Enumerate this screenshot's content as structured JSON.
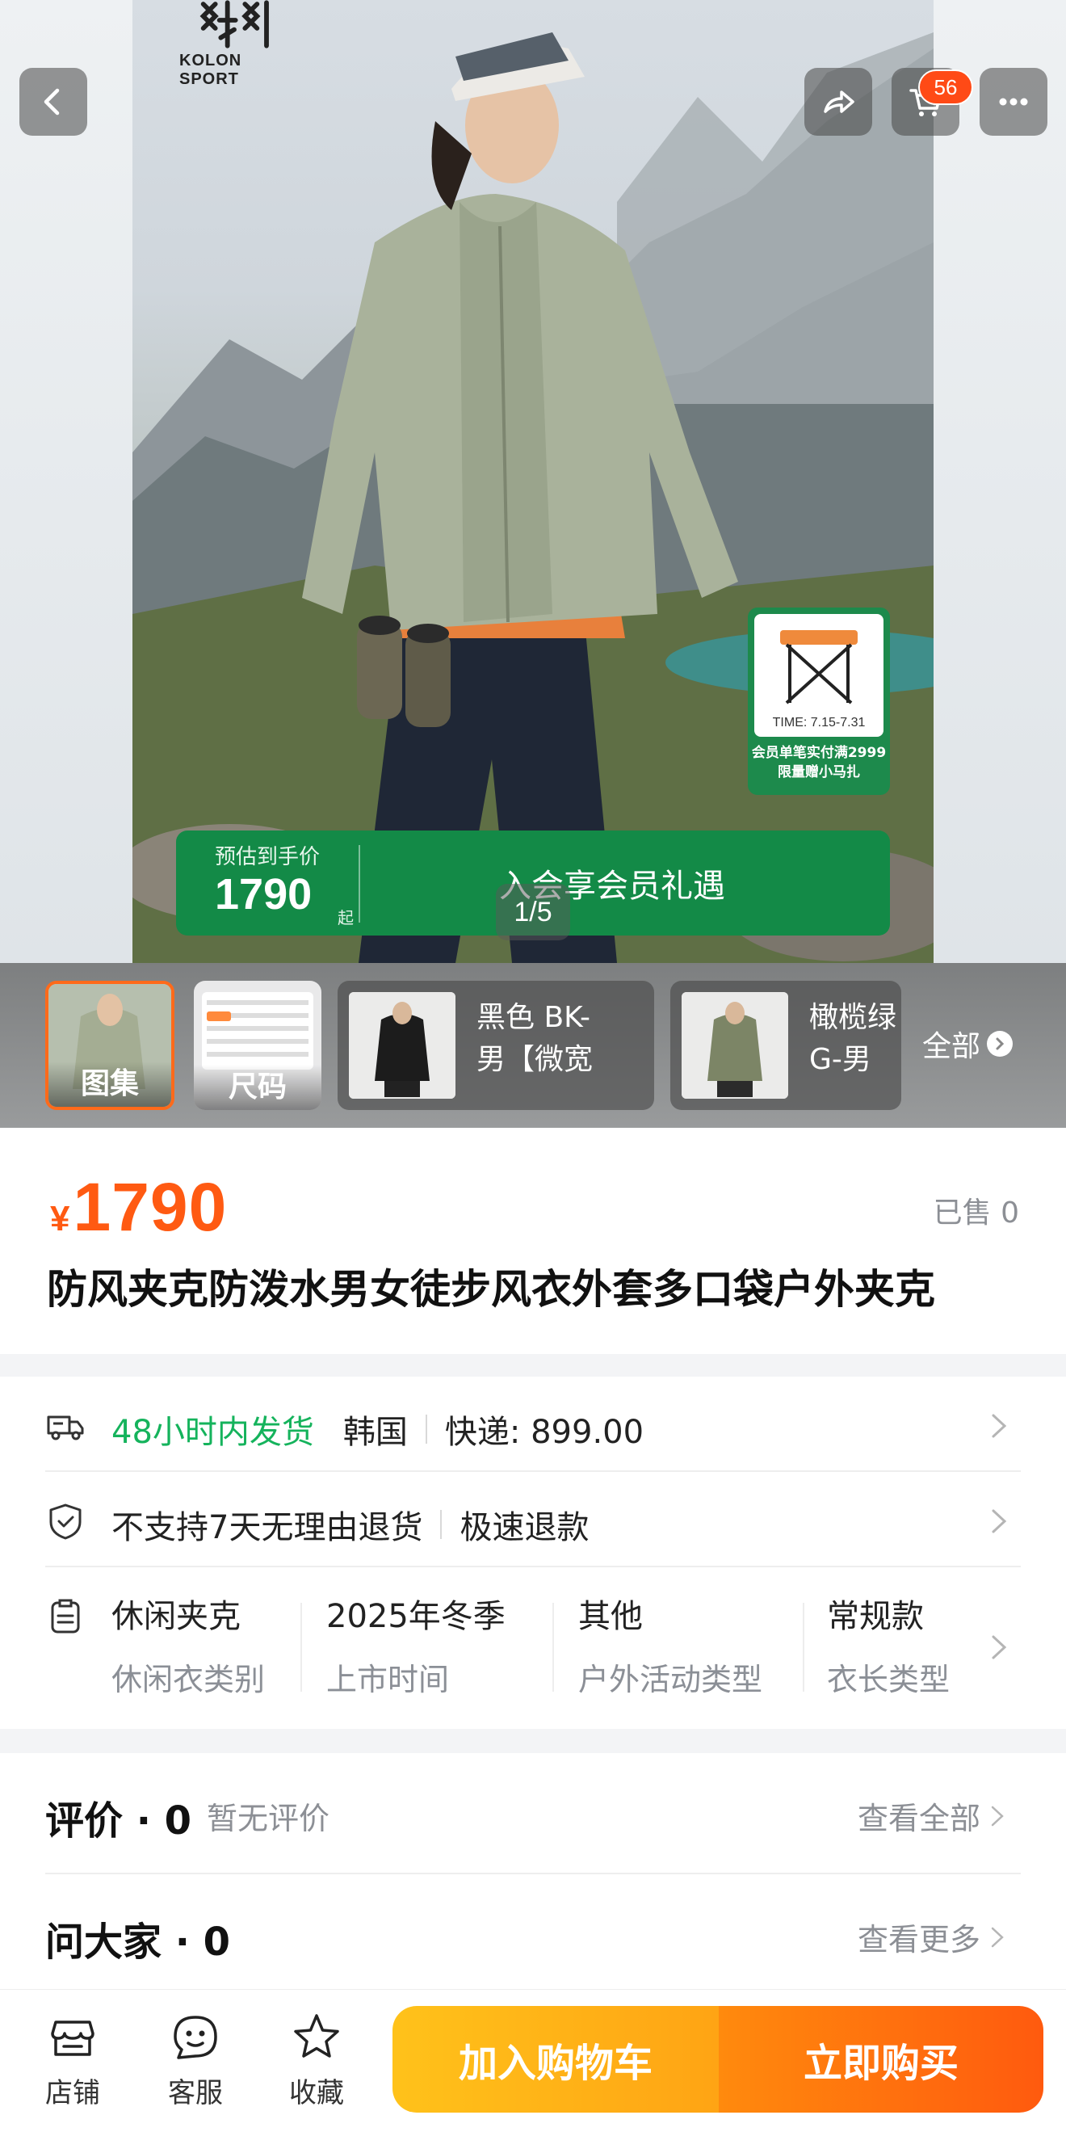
{
  "header": {
    "brand_text": "KOLON SPORT",
    "brand_mark_glyph": "猫",
    "cart_count": "56",
    "icons": {
      "back": "chevron-left-icon",
      "share": "share-icon",
      "cart": "cart-icon",
      "more": "more-dots-icon"
    }
  },
  "hero": {
    "promo_time": "TIME: 7.15-7.31",
    "promo_line1": "会员单笔实付满2999",
    "promo_line2": "限量赠小马扎",
    "est_label": "预估到手价",
    "est_value": "1790",
    "est_suffix": "起",
    "member_text": "入会享会员礼遇",
    "page_indicator": "1/5"
  },
  "thumbs": {
    "gallery_label": "图集",
    "size_label": "尺码",
    "variants": [
      {
        "line1": "黑色 BK-",
        "line2": "男【微宽"
      },
      {
        "line1": "橄榄绿",
        "line2": "G-男"
      }
    ],
    "show_all": "全部"
  },
  "product": {
    "currency": "¥",
    "price": "1790",
    "sold": "已售 0",
    "title": "防风夹克防泼水男女徒步风衣外套多口袋户外夹克"
  },
  "service": {
    "shipping": {
      "fast": "48小时内发货",
      "origin": "韩国",
      "express": "快递: 899.00"
    },
    "returns": {
      "policy": "不支持7天无理由退货",
      "refund": "极速退款"
    },
    "attributes": [
      {
        "value": "休闲夹克",
        "key": "休闲衣类别"
      },
      {
        "value": "2025年冬季",
        "key": "上市时间"
      },
      {
        "value": "其他",
        "key": "户外活动类型"
      },
      {
        "value": "常规款",
        "key": "衣长类型"
      }
    ]
  },
  "reviews": {
    "title": "评价 · 0",
    "empty": "暂无评价",
    "view_all": "查看全部",
    "qa_title": "问大家 · 0",
    "view_more": "查看更多"
  },
  "bottom_bar": {
    "store": "店铺",
    "service": "客服",
    "favorite": "收藏",
    "add_cart": "加入购物车",
    "buy_now": "立即购买"
  },
  "colors": {
    "accent_orange": "#ff5a12",
    "green_banner": "#138a47",
    "green_text": "#15b35c",
    "cart_yellow": "#ffc21a"
  }
}
